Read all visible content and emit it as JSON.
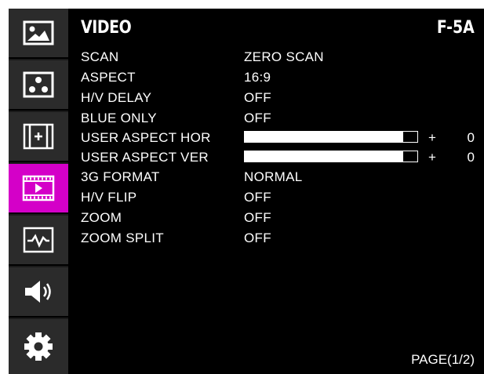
{
  "sidebar": {
    "items": [
      {
        "icon": "picture-icon",
        "active": false
      },
      {
        "icon": "color-dots-icon",
        "active": false
      },
      {
        "icon": "marker-icon",
        "active": false
      },
      {
        "icon": "video-film-icon",
        "active": true
      },
      {
        "icon": "waveform-icon",
        "active": false
      },
      {
        "icon": "speaker-icon",
        "active": false
      },
      {
        "icon": "gear-icon",
        "active": false
      }
    ],
    "active_color": "#d400c8"
  },
  "header": {
    "title": "VIDEO",
    "model": "F-5A"
  },
  "menu": {
    "scan": {
      "label": "SCAN",
      "value": "ZERO SCAN"
    },
    "aspect": {
      "label": "ASPECT",
      "value": "16:9"
    },
    "hv_delay": {
      "label": "H/V DELAY",
      "value": "OFF"
    },
    "blue_only": {
      "label": "BLUE ONLY",
      "value": "OFF"
    },
    "user_aspect_hor": {
      "label": "USER ASPECT HOR",
      "sign": "+",
      "value": "0",
      "level": 0.92
    },
    "user_aspect_ver": {
      "label": "USER ASPECT VER",
      "sign": "+",
      "value": "0",
      "level": 0.92
    },
    "format_3g": {
      "label": "3G FORMAT",
      "value": "NORMAL"
    },
    "hv_flip": {
      "label": "H/V FLIP",
      "value": "OFF"
    },
    "zoom": {
      "label": "ZOOM",
      "value": "OFF"
    },
    "zoom_split": {
      "label": "ZOOM SPLIT",
      "value": "OFF"
    }
  },
  "footer": {
    "page": "PAGE(1/2)"
  }
}
